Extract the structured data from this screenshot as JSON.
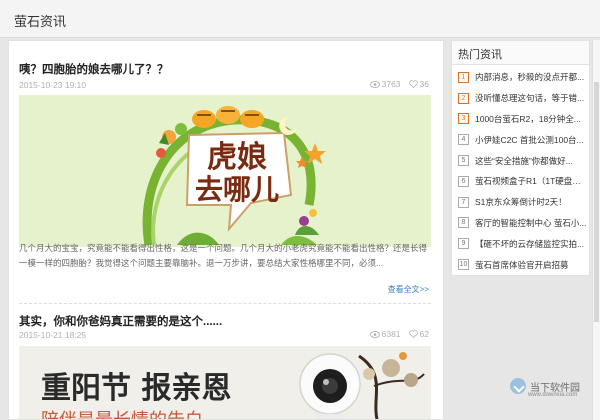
{
  "header": {
    "title": "萤石资讯"
  },
  "articles": [
    {
      "title": "咦？四胞胎的娘去哪儿了？？",
      "date": "2015-10-23 19:10",
      "views": "3763",
      "likes": "36",
      "banner_text": "虎娘去哪儿",
      "excerpt": "几个月大的宝宝，究竟能不能看得出性格，这是一个问题。几个月大的小老虎究竟能不能看出性格？还是长得一模一样的四胞胎？我觉得这个问题主要靠脑补。退一万步讲，要总结大家性格哪里不同，必须...",
      "readmore": "查看全文>>"
    },
    {
      "title": "其实，你和你爸妈真正需要的是这个......",
      "date": "2015-10-21 18:25",
      "views": "6381",
      "likes": "62",
      "banner_line1": "重阳节  报亲恩",
      "banner_line2": "陪伴是最长情的告白"
    }
  ],
  "sidebar": {
    "title": "热门资讯",
    "items": [
      {
        "num": "1",
        "label": "内部消息，秒殺的没点开都..."
      },
      {
        "num": "2",
        "label": "没听懂总理这句话，等于错..."
      },
      {
        "num": "3",
        "label": "1000台萤石R2，18分钟全..."
      },
      {
        "num": "4",
        "label": "小伊娃C2C 首批公测100台..."
      },
      {
        "num": "5",
        "label": "这些“安全措施”你都做好..."
      },
      {
        "num": "6",
        "label": "萤石视频盒子R1（1T硬盘豪..."
      },
      {
        "num": "7",
        "label": "S1京东众筹倒计时2天！"
      },
      {
        "num": "8",
        "label": "客厅的智能控制中心 萤石小..."
      },
      {
        "num": "9",
        "label": "【砸不坏的云存储监控实拍..."
      },
      {
        "num": "10",
        "label": "萤石首席体验官开启招募"
      }
    ]
  },
  "watermark": {
    "text": "当下软件园",
    "url": "www.downxia.com"
  },
  "colors": {
    "accent": "#e07020",
    "link": "#3a7fc1"
  }
}
